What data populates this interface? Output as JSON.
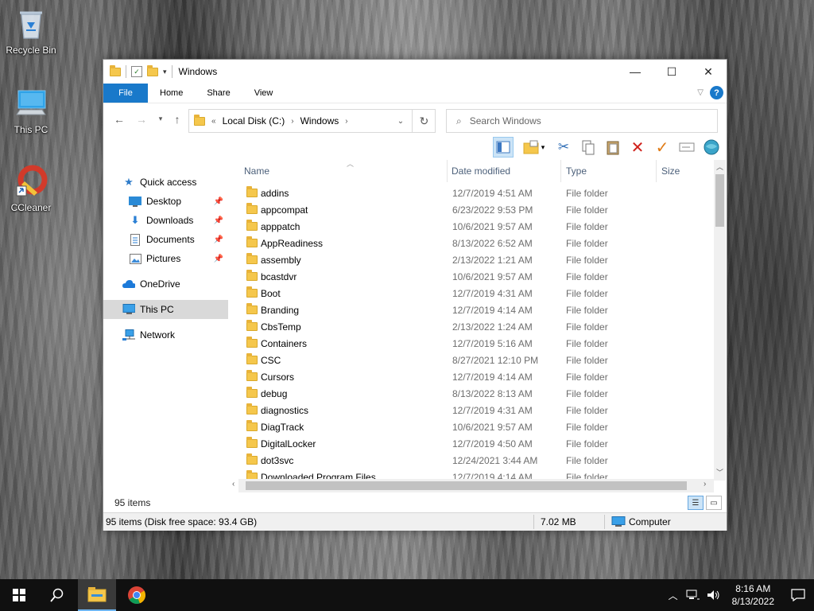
{
  "desktop": {
    "icons": [
      {
        "label": "Recycle Bin",
        "icon": "recycle-bin-icon"
      },
      {
        "label": "This PC",
        "icon": "this-pc-icon"
      },
      {
        "label": "CCleaner",
        "icon": "ccleaner-icon"
      }
    ]
  },
  "window": {
    "title": "Windows",
    "ribbon_tabs": [
      "File",
      "Home",
      "Share",
      "View"
    ],
    "address": {
      "overflow": "«",
      "crumbs": [
        "Local Disk (C:)",
        "Windows"
      ]
    },
    "search_placeholder": "Search Windows",
    "nav": {
      "quick_access": "Quick access",
      "pinned": [
        "Desktop",
        "Downloads",
        "Documents",
        "Pictures"
      ],
      "onedrive": "OneDrive",
      "this_pc": "This PC",
      "network": "Network"
    },
    "columns": [
      "Name",
      "Date modified",
      "Type",
      "Size"
    ],
    "files": [
      {
        "name": "addins",
        "date": "12/7/2019 4:51 AM",
        "type": "File folder"
      },
      {
        "name": "appcompat",
        "date": "6/23/2022 9:53 PM",
        "type": "File folder"
      },
      {
        "name": "apppatch",
        "date": "10/6/2021 9:57 AM",
        "type": "File folder"
      },
      {
        "name": "AppReadiness",
        "date": "8/13/2022 6:52 AM",
        "type": "File folder"
      },
      {
        "name": "assembly",
        "date": "2/13/2022 1:21 AM",
        "type": "File folder"
      },
      {
        "name": "bcastdvr",
        "date": "10/6/2021 9:57 AM",
        "type": "File folder"
      },
      {
        "name": "Boot",
        "date": "12/7/2019 4:31 AM",
        "type": "File folder"
      },
      {
        "name": "Branding",
        "date": "12/7/2019 4:14 AM",
        "type": "File folder"
      },
      {
        "name": "CbsTemp",
        "date": "2/13/2022 1:24 AM",
        "type": "File folder"
      },
      {
        "name": "Containers",
        "date": "12/7/2019 5:16 AM",
        "type": "File folder"
      },
      {
        "name": "CSC",
        "date": "8/27/2021 12:10 PM",
        "type": "File folder"
      },
      {
        "name": "Cursors",
        "date": "12/7/2019 4:14 AM",
        "type": "File folder"
      },
      {
        "name": "debug",
        "date": "8/13/2022 8:13 AM",
        "type": "File folder"
      },
      {
        "name": "diagnostics",
        "date": "12/7/2019 4:31 AM",
        "type": "File folder"
      },
      {
        "name": "DiagTrack",
        "date": "10/6/2021 9:57 AM",
        "type": "File folder"
      },
      {
        "name": "DigitalLocker",
        "date": "12/7/2019 4:50 AM",
        "type": "File folder"
      },
      {
        "name": "dot3svc",
        "date": "12/24/2021 3:44 AM",
        "type": "File folder"
      },
      {
        "name": "Downloaded Program Files",
        "date": "12/7/2019 4:14 AM",
        "type": "File folder"
      }
    ],
    "item_count": "95 items",
    "status": {
      "left": "95 items (Disk free space: 93.4 GB)",
      "size": "7.02 MB",
      "location": "Computer"
    }
  },
  "taskbar": {
    "time": "8:16 AM",
    "date": "8/13/2022"
  },
  "colors": {
    "accent": "#1979ca",
    "folder": "#f5c74c",
    "taskbar": "#101010"
  }
}
